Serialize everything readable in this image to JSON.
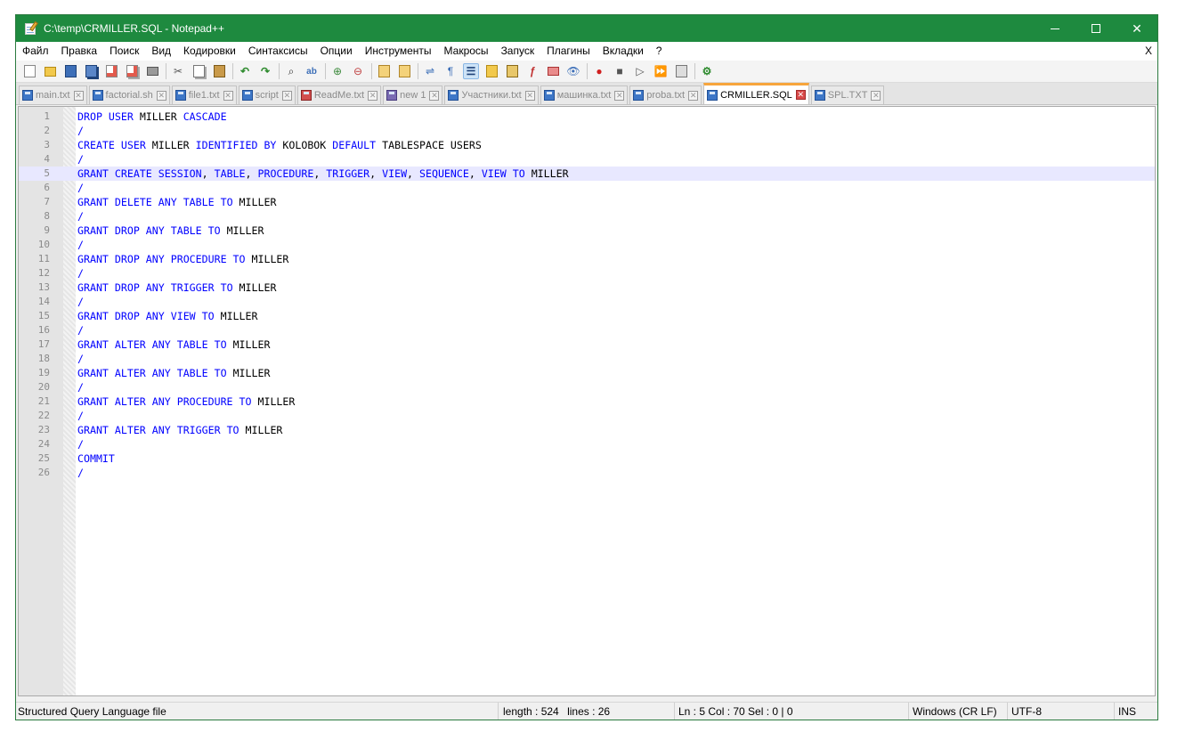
{
  "window": {
    "title": "C:\\temp\\CRMILLER.SQL - Notepad++"
  },
  "menu": [
    "Файл",
    "Правка",
    "Поиск",
    "Вид",
    "Кодировки",
    "Синтаксисы",
    "Опции",
    "Инструменты",
    "Макросы",
    "Запуск",
    "Плагины",
    "Вкладки",
    "?"
  ],
  "menu_close": "X",
  "toolbar": [
    "new-file-icon",
    "open-file-icon",
    "save-icon",
    "save-all-icon",
    "close-icon",
    "close-all-icon",
    "print-icon",
    "cut-icon",
    "copy-icon",
    "paste-icon",
    "undo-icon",
    "redo-icon",
    "find-icon",
    "replace-icon",
    "zoom-in-icon",
    "zoom-out-icon",
    "sync-vertical-icon",
    "sync-horizontal-icon",
    "word-wrap-icon",
    "show-all-chars-icon",
    "indent-guide-icon",
    "user-lang-icon",
    "doc-map-icon",
    "function-list-icon",
    "folder-workspace-icon",
    "monitoring-icon",
    "record-macro-icon",
    "stop-record-icon",
    "play-macro-icon",
    "run-macro-multiple-icon",
    "save-macro-icon",
    "plugin-icon"
  ],
  "tabs": [
    {
      "label": "main.txt",
      "active": false
    },
    {
      "label": "factorial.sh",
      "active": false
    },
    {
      "label": "file1.txt",
      "active": false
    },
    {
      "label": "script",
      "active": false
    },
    {
      "label": "ReadMe.txt",
      "active": false,
      "modified": true
    },
    {
      "label": "new 1",
      "active": false,
      "modified2": true
    },
    {
      "label": "Участники.txt",
      "active": false
    },
    {
      "label": "машинка.txt",
      "active": false
    },
    {
      "label": "proba.txt",
      "active": false
    },
    {
      "label": "CRMILLER.SQL",
      "active": true
    },
    {
      "label": "SPL.TXT",
      "active": false
    }
  ],
  "editor": {
    "current_line": 5,
    "lines": [
      "DROP USER MILLER CASCADE",
      "/",
      "CREATE USER MILLER IDENTIFIED BY KOLOBOK DEFAULT TABLESPACE USERS",
      "/",
      "GRANT CREATE SESSION, TABLE, PROCEDURE, TRIGGER, VIEW, SEQUENCE, VIEW TO MILLER",
      "/",
      "GRANT DELETE ANY TABLE TO MILLER",
      "/",
      "GRANT DROP ANY TABLE TO MILLER",
      "/",
      "GRANT DROP ANY PROCEDURE TO MILLER",
      "/",
      "GRANT DROP ANY TRIGGER TO MILLER",
      "/",
      "GRANT DROP ANY VIEW TO MILLER",
      "/",
      "GRANT ALTER ANY TABLE TO MILLER",
      "/",
      "GRANT ALTER ANY TABLE TO MILLER",
      "/",
      "GRANT ALTER ANY PROCEDURE TO MILLER",
      "/",
      "GRANT ALTER ANY TRIGGER TO MILLER",
      "/",
      "COMMIT",
      "/"
    ]
  },
  "status": {
    "file_type": "Structured Query Language file",
    "length": "length : 524",
    "lines": "lines : 26",
    "position": "Ln : 5    Col : 70    Sel : 0 | 0",
    "eol": "Windows (CR LF)",
    "encoding": "UTF-8",
    "mode": "INS"
  },
  "colors": {
    "titlebar": "#1e8a3f",
    "keyword": "#0000ff",
    "active_tab_accent": "#f7a53c",
    "current_line": "#e8e8ff"
  }
}
